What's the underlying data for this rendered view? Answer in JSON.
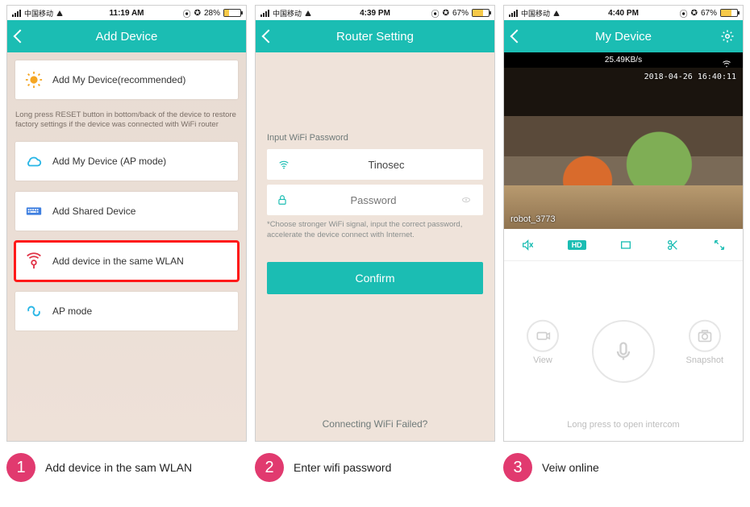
{
  "screen1": {
    "status": {
      "carrier": "中国移动",
      "time": "11:19 AM",
      "battery_label": "28%",
      "battery_fill": 28
    },
    "title": "Add Device",
    "card_add_my": "Add My Device(recommended)",
    "desc": "Long press RESET button in bottom/back of the device to restore factory settings if the device was connected with WiFi router",
    "card_ap": "Add My Device (AP mode)",
    "card_shared": "Add Shared Device",
    "card_wlan": "Add device in the same WLAN",
    "card_apmode": "AP mode"
  },
  "screen2": {
    "status": {
      "carrier": "中国移动",
      "time": "4:39 PM",
      "battery_label": "67%",
      "battery_fill": 67
    },
    "title": "Router Setting",
    "label": "Input WiFi Password",
    "ssid": "Tinosec",
    "password_placeholder": "Password",
    "note": "*Choose stronger WiFi signal, input the correct password, accelerate the device connect with Internet.",
    "confirm": "Confirm",
    "footer": "Connecting WiFi Failed?"
  },
  "screen3": {
    "status": {
      "carrier": "中国移动",
      "time": "4:40 PM",
      "battery_label": "67%",
      "battery_fill": 67
    },
    "title": "My Device",
    "rate": "25.49KB/s",
    "timestamp": "2018-04-26 16:40:11",
    "cam_name": "robot_3773",
    "hd": "HD",
    "view_label": "View",
    "snapshot_label": "Snapshot",
    "intercom_hint": "Long press to open intercom"
  },
  "captions": {
    "c1_num": "1",
    "c1": "Add device in the sam WLAN",
    "c2_num": "2",
    "c2": "Enter wifi password",
    "c3_num": "3",
    "c3": "Veiw online"
  }
}
